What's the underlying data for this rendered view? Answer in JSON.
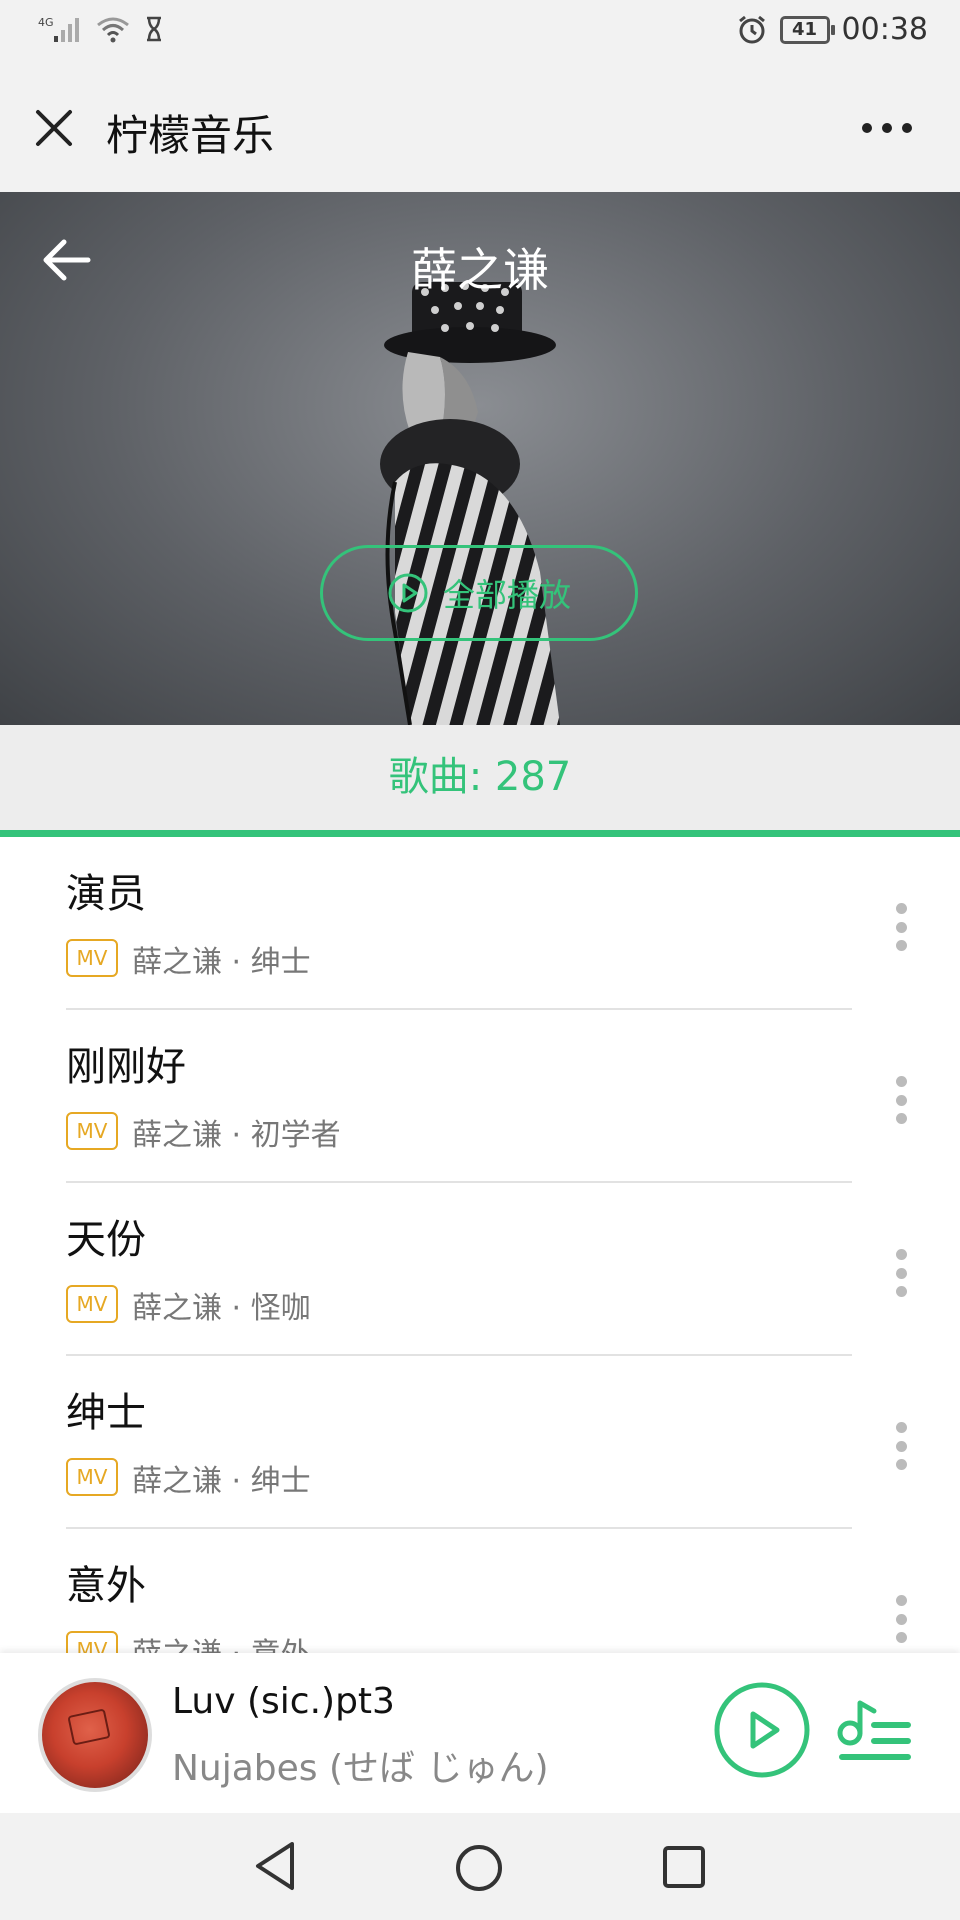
{
  "status_bar": {
    "network": "4G",
    "battery": "41",
    "time": "00:38"
  },
  "title_bar": {
    "title": "柠檬音乐"
  },
  "hero": {
    "artist_name": "薛之谦",
    "play_all_label": "全部播放"
  },
  "count_bar": {
    "label": "歌曲: 287"
  },
  "songs": [
    {
      "title": "演员",
      "badge": "MV",
      "meta": "薛之谦 · 绅士"
    },
    {
      "title": "刚刚好",
      "badge": "MV",
      "meta": "薛之谦 · 初学者"
    },
    {
      "title": "天份",
      "badge": "MV",
      "meta": "薛之谦 · 怪咖"
    },
    {
      "title": "绅士",
      "badge": "MV",
      "meta": "薛之谦 · 绅士"
    },
    {
      "title": "意外",
      "badge": "MV",
      "meta": "薛之谦 · 意外"
    }
  ],
  "mini_player": {
    "track_title": "Luv (sic.)pt3",
    "track_artist": "Nujabes (せば じゅん)"
  },
  "colors": {
    "accent": "#34c37a",
    "badge": "#e6a823"
  }
}
